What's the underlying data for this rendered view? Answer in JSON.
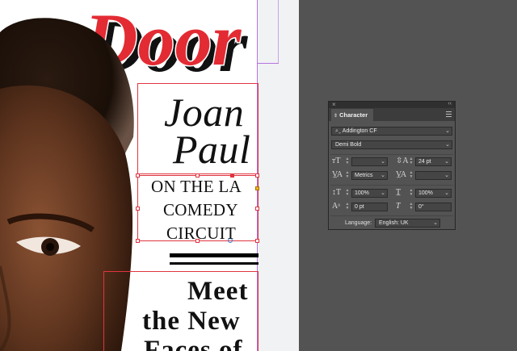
{
  "document": {
    "masthead": "Door",
    "headline_line1": "Joan",
    "headline_line2": "Paul",
    "subhead_lines": [
      "ON THE LA",
      "COMEDY",
      "CIRCUIT"
    ],
    "feature_lines": [
      "Meet",
      "the New",
      "Faces of"
    ],
    "colors": {
      "masthead_red": "#e32b33",
      "frame_red": "#e0343f",
      "guide_purple": "#b574e0"
    }
  },
  "character_panel": {
    "close_icon": "close-icon",
    "collapse_icon": "double-chevron-icon",
    "tab_label": "Character",
    "font_family": "Addington CF",
    "font_style": "Demi Bold",
    "font_size": "",
    "leading": "24 pt",
    "kerning": "Metrics",
    "tracking": "",
    "vertical_scale": "100%",
    "horizontal_scale": "100%",
    "baseline_shift": "0 pt",
    "skew": "0°",
    "language_label": "Language:",
    "language": "English: UK"
  }
}
